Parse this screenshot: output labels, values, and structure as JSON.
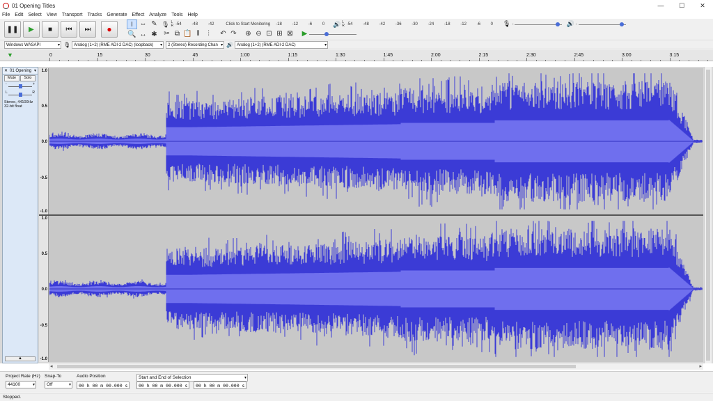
{
  "window": {
    "title": "01 Opening Titles",
    "controls": [
      "—",
      "☐",
      "✕"
    ]
  },
  "menu": [
    "File",
    "Edit",
    "Select",
    "View",
    "Transport",
    "Tracks",
    "Generate",
    "Effect",
    "Analyze",
    "Tools",
    "Help"
  ],
  "transport": {
    "pause": "❚❚",
    "play": "▶",
    "stop": "■",
    "skip_start": "⏮",
    "skip_end": "⏭",
    "record": "●"
  },
  "tools": [
    "I",
    "⇔",
    "✎",
    "🔍",
    "↔",
    "✱"
  ],
  "recording_meter": {
    "icon": "mic-icon",
    "scale": [
      "-54",
      "-48",
      "-42",
      "Click to Start Monitoring",
      "-18",
      "-12",
      "-6",
      "0"
    ]
  },
  "playback_meter": {
    "icon": "speaker-icon",
    "scale": [
      "-54",
      "-48",
      "-42",
      "-36",
      "-30",
      "-24",
      "-18",
      "-12",
      "-6",
      "0"
    ]
  },
  "meter_lr": "L\nR",
  "edit_tools": [
    "✂",
    "⧉",
    "📋",
    "⫴",
    "⫶",
    "↶",
    "↷",
    "⊕",
    "⊖",
    "⊡",
    "⊞",
    "⊠",
    "▶"
  ],
  "sliders": {
    "record_volume": 0.95,
    "playback_volume": 0.95,
    "play_at_speed": 0.35,
    "minus": "-",
    "plus": "+"
  },
  "devices": {
    "host": "Windows WASAPI",
    "recording_device": "Analog (1+2) (RME ADI-2 DAC) (loopback)",
    "channels": "2 (Stereo) Recording Chan",
    "playback_device": "Analog (1+2) (RME ADI-2 DAC)"
  },
  "timeline": {
    "ticks": [
      "0",
      "15",
      "30",
      "45",
      "1:00",
      "1:15",
      "1:30",
      "1:45",
      "2:00",
      "2:15",
      "2:30",
      "2:45",
      "3:00",
      "3:15"
    ]
  },
  "track": {
    "close": "✕",
    "name": "01 Opening",
    "mute": "Mute",
    "solo": "Solo",
    "gain_minus": "-",
    "gain_plus": "+",
    "pan_left": "L",
    "pan_right": "R",
    "info_line1": "Stereo, 44100Hz",
    "info_line2": "32-bit float",
    "collapse": "▲",
    "scale": [
      "1.0",
      "0.5",
      "0.0",
      "-0.5",
      "-1.0"
    ]
  },
  "colors": {
    "waveform": "#3b3bd6",
    "waveform_rms": "#6f6fee",
    "track_bg": "#c8c8c8"
  },
  "selection_bar": {
    "project_rate_label": "Project Rate (Hz)",
    "project_rate": "44100",
    "snap_to_label": "Snap-To",
    "snap_to": "Off",
    "audio_position_label": "Audio Position",
    "audio_position": "00 h 00 m 00.000 s",
    "selection_label": "Start and End of Selection",
    "selection_start": "00 h 00 m 00.000 s",
    "selection_end": "00 h 00 m 00.000 s"
  },
  "status": "Stopped."
}
